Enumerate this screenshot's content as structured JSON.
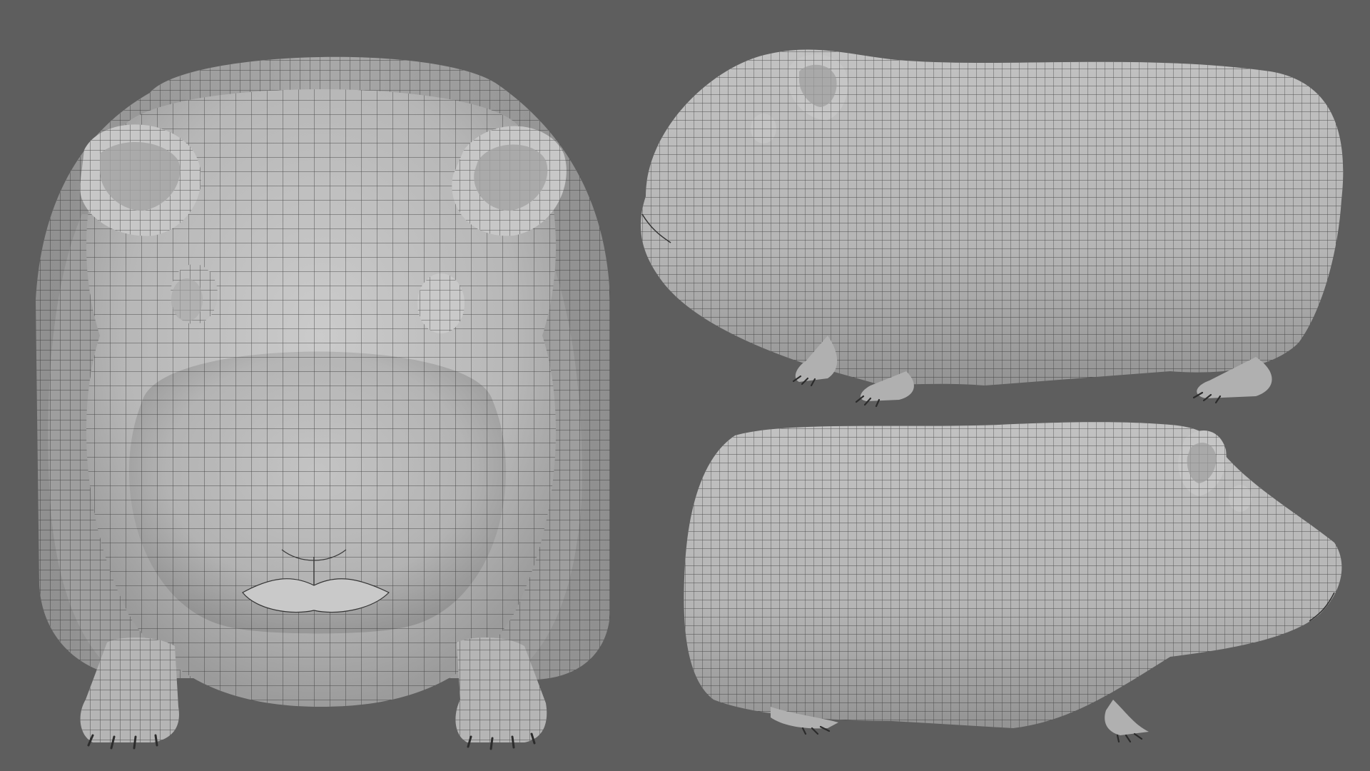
{
  "scene": {
    "background_color": "#5e5e5e",
    "mesh_base_color": "#b9b9b9",
    "mesh_shadow_color": "#8a8a8a",
    "mesh_highlight_color": "#d6d6d6",
    "wire_color": "#2a2a2a"
  },
  "views": [
    {
      "name": "front-view"
    },
    {
      "name": "side-view-facing-left"
    },
    {
      "name": "side-view-facing-right"
    }
  ]
}
